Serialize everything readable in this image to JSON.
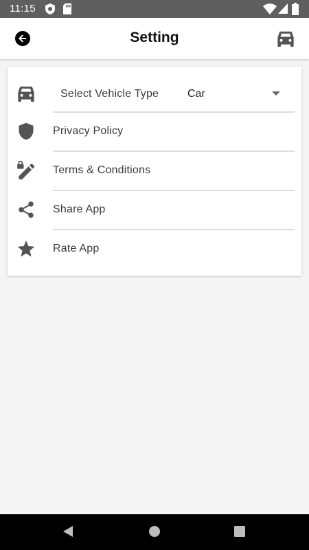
{
  "status_bar": {
    "time": "11:15",
    "icons": [
      "shield-notification-icon",
      "sd-card-icon",
      "wifi-icon",
      "signal-icon",
      "battery-icon"
    ]
  },
  "app_bar": {
    "title": "Setting",
    "back_icon": "arrow-back-circle-icon",
    "action_icon": "car-icon"
  },
  "settings": {
    "vehicle": {
      "label": "Select Vehicle Type",
      "value": "Car",
      "icon": "car-icon"
    },
    "items": [
      {
        "label": "Privacy Policy",
        "icon": "shield-icon"
      },
      {
        "label": "Terms & Conditions",
        "icon": "edit-lock-icon"
      },
      {
        "label": "Share App",
        "icon": "share-icon"
      },
      {
        "label": "Rate App",
        "icon": "star-icon"
      }
    ]
  },
  "nav_bar": {
    "buttons": [
      "back-triangle-icon",
      "home-circle-icon",
      "recents-square-icon"
    ]
  },
  "colors": {
    "status_bar": "#5f5f5f",
    "icon_gray": "#545454",
    "background": "#f4f4f4",
    "divider": "#dcdcdc"
  }
}
